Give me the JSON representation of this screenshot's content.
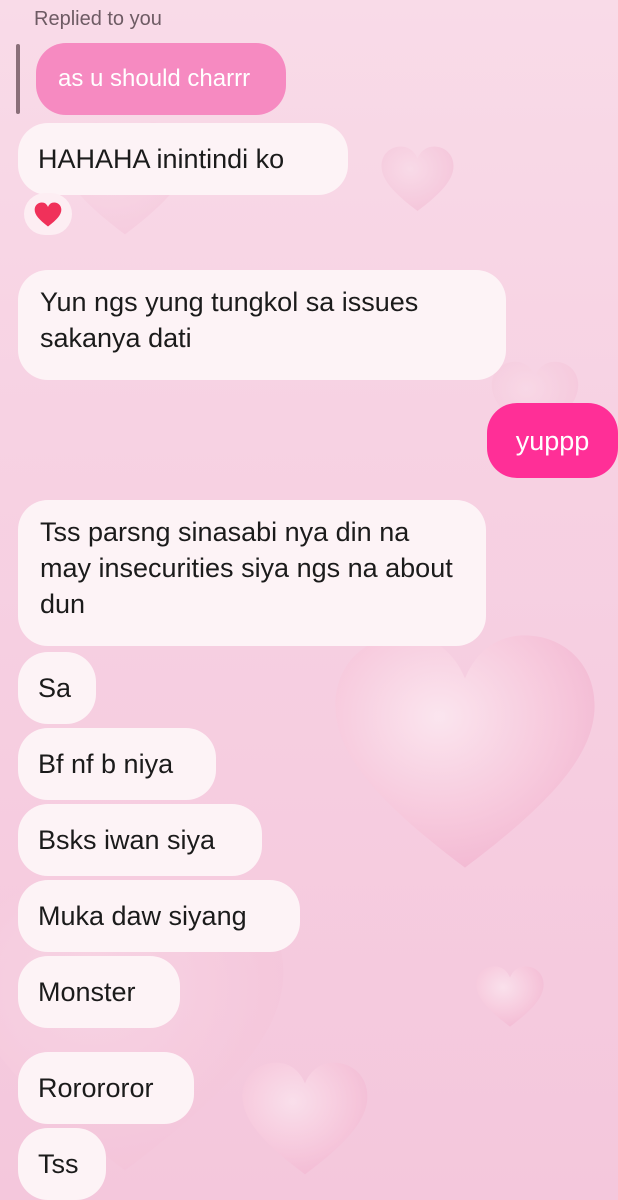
{
  "reply_context": {
    "label": "Replied to you",
    "quoted_message": "as u should charrr"
  },
  "reaction": {
    "emoji": "heart-icon",
    "color": "#f0315a"
  },
  "messages": [
    {
      "sender": "them",
      "text": "HAHAHA inintindi ko"
    },
    {
      "sender": "them",
      "text": "Yun ngs yung tungkol sa issues sakanya dati"
    },
    {
      "sender": "me",
      "text": "yuppp"
    },
    {
      "sender": "them",
      "text": "Tss parsng sinasabi nya din na may insecurities siya ngs na about dun"
    },
    {
      "sender": "them",
      "text": "Sa"
    },
    {
      "sender": "them",
      "text": "Bf nf b niya"
    },
    {
      "sender": "them",
      "text": "Bsks iwan siya"
    },
    {
      "sender": "them",
      "text": "Muka daw siyang"
    },
    {
      "sender": "them",
      "text": "Monster"
    },
    {
      "sender": "them",
      "text": "Rorororor"
    },
    {
      "sender": "them",
      "text": "Tss"
    }
  ],
  "theme": {
    "my_bubble": "#ff2f97",
    "their_bubble": "#fdf3f6",
    "quoted_bubble": "#f68ac1",
    "background": "#f7d2e3"
  }
}
